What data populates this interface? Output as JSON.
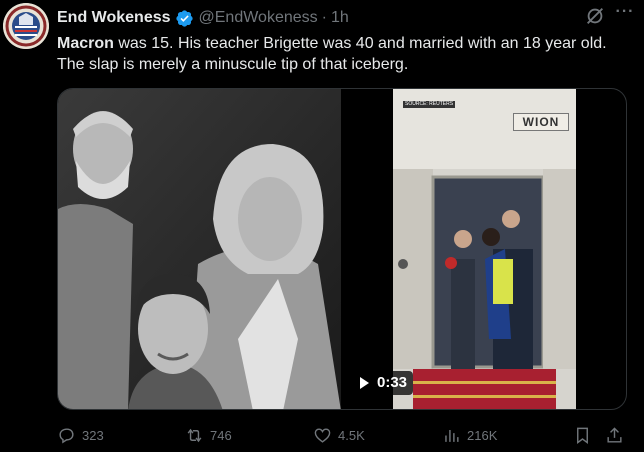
{
  "tweet": {
    "author_name": "End Wokeness",
    "handle": "@EndWokeness",
    "separator": "·",
    "time": "1h",
    "more_icon": "more-icon",
    "text_bold": "Macron",
    "text_rest": " was 15. His teacher Brigette was 40 and married with an 18 year old. The slap is merely a minuscule tip of that iceberg."
  },
  "media": {
    "video_brand": "WION",
    "video_source": "SOURCE: REUTERS",
    "duration": "0:33"
  },
  "actions": {
    "replies": "323",
    "reposts": "746",
    "likes": "4.5K",
    "views": "216K"
  },
  "colors": {
    "background": "#000000",
    "text": "#e7e9ea",
    "muted": "#71767b",
    "verified": "#1d9bf0"
  }
}
